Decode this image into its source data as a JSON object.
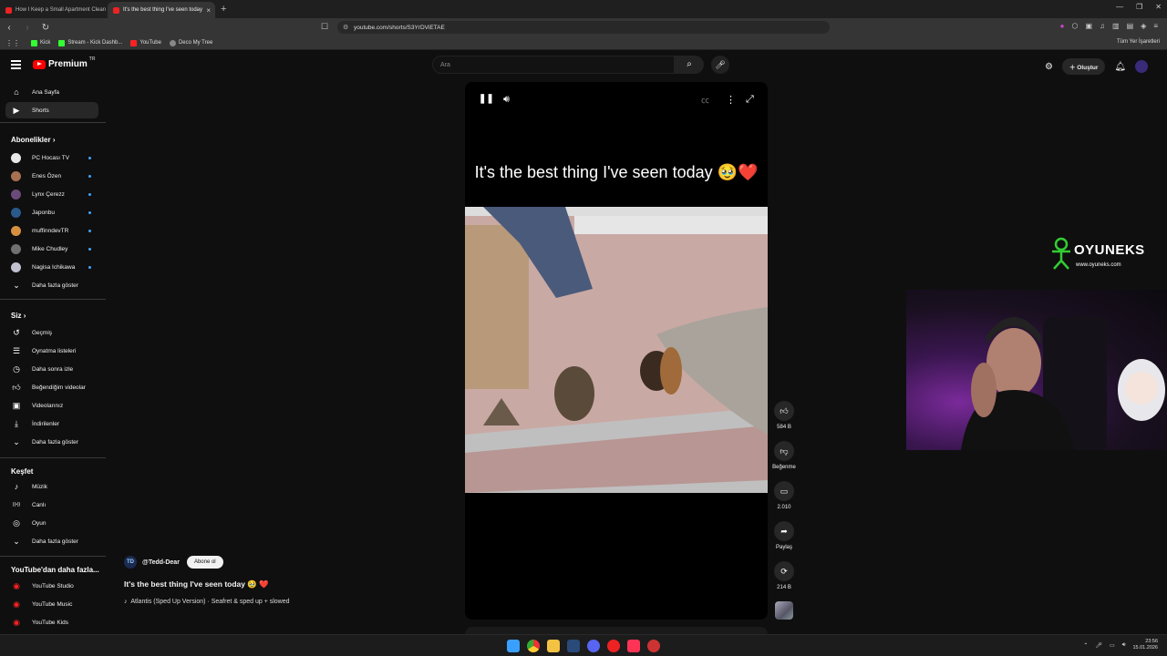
{
  "browser": {
    "tabs": [
      {
        "label": "How I Keep a Small Apartment Clean",
        "active": false
      },
      {
        "label": "It's the best thing I've seen today",
        "active": true
      }
    ],
    "url": "youtube.com/shorts/S3YrDViETAE",
    "bookmarks": [
      "Kick",
      "Stream - Kick Dashb...",
      "YouTube",
      "Deco My Tree"
    ],
    "bookmarks_right": "Tüm Yer İşaretleri"
  },
  "header": {
    "logo": "Premium",
    "logo_region": "TR",
    "search_placeholder": "Ara",
    "create_label": "Oluştur"
  },
  "sidebar": {
    "main": [
      {
        "label": "Ana Sayfa",
        "icon": "home-icon"
      },
      {
        "label": "Shorts",
        "icon": "shorts-icon",
        "active": true
      }
    ],
    "subscriptions_title": "Abonelikler",
    "subscriptions": [
      {
        "label": "PC Hocası TV",
        "color": "#e8e8e8"
      },
      {
        "label": "Enes Özen",
        "color": "#a87050"
      },
      {
        "label": "Lynx Çerezz",
        "color": "#6a4a7a"
      },
      {
        "label": "Japonbu",
        "color": "#2a5a8a"
      },
      {
        "label": "muffinndevTR",
        "color": "#d89040"
      },
      {
        "label": "Mike Chudley",
        "color": "#707070"
      },
      {
        "label": "Nagisa Ichikawa",
        "color": "#c0c0d0"
      }
    ],
    "show_more": "Daha fazla göster",
    "you_title": "Siz",
    "you_items": [
      {
        "label": "Geçmiş",
        "icon": "history-icon"
      },
      {
        "label": "Oynatma listeleri",
        "icon": "playlist-icon"
      },
      {
        "label": "Daha sonra izle",
        "icon": "clock-icon"
      },
      {
        "label": "Beğendiğim videolar",
        "icon": "like-icon"
      },
      {
        "label": "Videolarınız",
        "icon": "video-icon"
      },
      {
        "label": "İndirilenler",
        "icon": "download-icon"
      },
      {
        "label": "Daha fazla göster",
        "icon": "chevron-down-icon"
      }
    ],
    "explore_title": "Keşfet",
    "explore_items": [
      {
        "label": "Müzik",
        "icon": "music-icon"
      },
      {
        "label": "Canlı",
        "icon": "live-icon"
      },
      {
        "label": "Oyun",
        "icon": "game-icon"
      },
      {
        "label": "Daha fazla göster",
        "icon": "chevron-down-icon"
      }
    ],
    "more_title": "YouTube'dan daha fazla...",
    "more_items": [
      {
        "label": "YouTube Studio"
      },
      {
        "label": "YouTube Music"
      },
      {
        "label": "YouTube Kids"
      }
    ]
  },
  "short": {
    "caption": "It's the best thing I've seen today 🥹❤️",
    "likes": "584 B",
    "dislike_label": "Beğenme",
    "comments": "2.010",
    "share_label": "Paylaş",
    "remix_count": "214 B",
    "channel": "@Tedd-Dear",
    "subscribe_label": "Abone ol",
    "title": "It's the best thing I've seen today 🥹 ❤️",
    "music": "Atlantis (Sped Up Version) · Seafret & sped up + slowed"
  },
  "overlay": {
    "brand": "OYUNEKS",
    "brand_url": "www.oyuneks.com"
  },
  "taskbar": {
    "time": "23:56",
    "date": "15.01.2026"
  }
}
